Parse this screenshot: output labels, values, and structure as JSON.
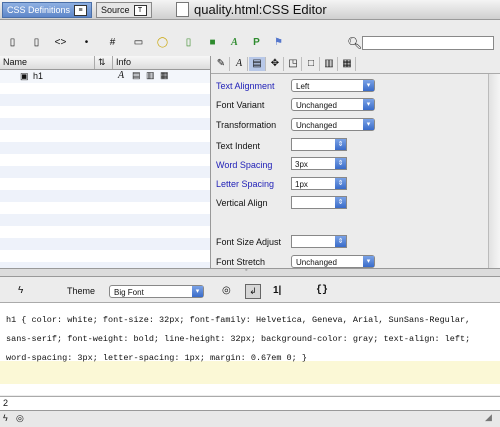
{
  "window": {
    "title": "quality.html:CSS Editor"
  },
  "tabs": [
    {
      "label": "CSS Definitions"
    },
    {
      "label": "Source"
    }
  ],
  "search": {
    "value": ""
  },
  "rules_table": {
    "columns": [
      "Name",
      "Info"
    ],
    "rows": [
      {
        "name": "h1"
      }
    ]
  },
  "properties": [
    {
      "label": "Text Alignment",
      "value": "Left",
      "control": "dropdown",
      "highlight": true
    },
    {
      "label": "Font Variant",
      "value": "Unchanged",
      "control": "dropdown",
      "highlight": false
    },
    {
      "label": "Transformation",
      "value": "Unchanged",
      "control": "dropdown",
      "highlight": false
    },
    {
      "label": "Text Indent",
      "value": "",
      "control": "combo",
      "highlight": false
    },
    {
      "label": "Word Spacing",
      "value": "3px",
      "control": "combo",
      "highlight": true
    },
    {
      "label": "Letter Spacing",
      "value": "1px",
      "control": "combo",
      "highlight": true
    },
    {
      "label": "Vertical Align",
      "value": "",
      "control": "combo",
      "highlight": false
    },
    {
      "label": "Font Size Adjust",
      "value": "",
      "control": "combo",
      "highlight": false
    },
    {
      "label": "Font Stretch",
      "value": "Unchanged",
      "control": "dropdown",
      "highlight": false
    }
  ],
  "codebar": {
    "theme_label": "Theme",
    "theme_value": "Big Font",
    "braces": "{}"
  },
  "code": {
    "text": "h1 { color: white; font-size: 32px; font-family: Helvetica, Geneva, Arial, SunSans-Regular, sans-serif; font-weight: bold; line-height: 32px; background-color: gray; text-align: left; word-spacing: 3px; letter-spacing: 1px; margin: 0.67em 0; }"
  },
  "line_number": "2",
  "colors": {
    "label_blue": "#2222b8",
    "highlight": "#fbf8d6",
    "active_tab": "#5e86c9"
  }
}
